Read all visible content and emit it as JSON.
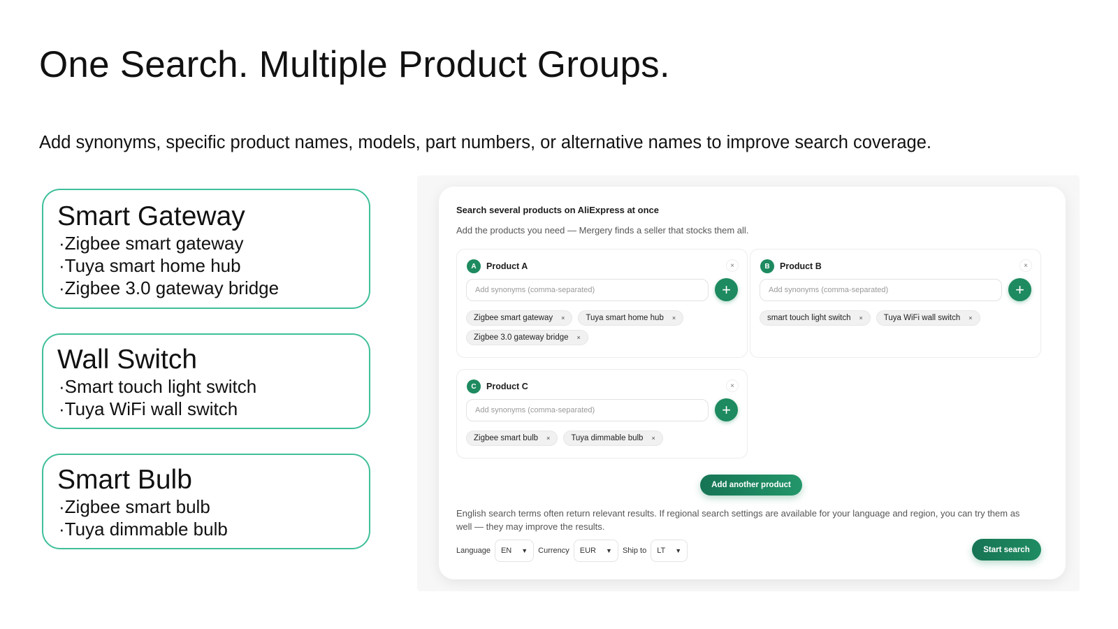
{
  "title": "One Search. Multiple Product Groups.",
  "subtitle": "Add synonyms, specific product names, models, part numbers, or alternative names to improve search coverage.",
  "groups": [
    {
      "title": "Smart Gateway",
      "items": [
        "Zigbee smart gateway",
        "Tuya smart home hub",
        "Zigbee 3.0 gateway bridge"
      ]
    },
    {
      "title": "Wall Switch",
      "items": [
        "Smart touch light switch",
        "Tuya WiFi wall switch"
      ]
    },
    {
      "title": "Smart Bulb",
      "items": [
        "Zigbee smart bulb",
        "Tuya dimmable bulb"
      ]
    }
  ],
  "panel": {
    "heading": "Search several products on AliExpress at once",
    "subheading": "Add the products you need — Mergery finds a seller that stocks them all.",
    "synonyms_placeholder": "Add synonyms (comma-separated)",
    "close_symbol": "×",
    "add_symbol": "+",
    "products": [
      {
        "badge": "A",
        "name": "Product A",
        "chips": [
          "Zigbee smart gateway",
          "Tuya smart home hub",
          "Zigbee 3.0 gateway bridge"
        ]
      },
      {
        "badge": "B",
        "name": "Product B",
        "chips": [
          "smart touch light switch",
          "Tuya WiFi wall switch"
        ]
      },
      {
        "badge": "C",
        "name": "Product C",
        "chips": [
          "Zigbee smart bulb",
          "Tuya dimmable bulb"
        ]
      }
    ],
    "add_another_label": "Add another product",
    "note": "English search terms often return relevant results. If regional search settings are available for your language and region, you can try them as well — they may improve the results.",
    "settings": {
      "language_label": "Language",
      "language_value": "EN",
      "currency_label": "Currency",
      "currency_value": "EUR",
      "ship_label": "Ship to",
      "ship_value": "LT"
    },
    "start_label": "Start search"
  },
  "colors": {
    "accent": "#1d8a5f",
    "card_border": "#3fbf9a"
  }
}
